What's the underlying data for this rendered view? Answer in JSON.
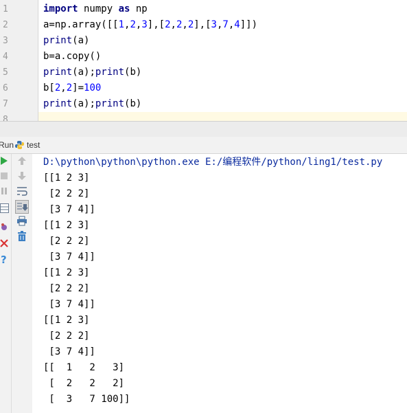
{
  "editor": {
    "line_numbers": [
      "1",
      "2",
      "3",
      "4",
      "5",
      "6",
      "7",
      "8"
    ],
    "lines": [
      {
        "segments": [
          {
            "t": "import",
            "c": "kw"
          },
          {
            "t": " numpy ",
            "c": ""
          },
          {
            "t": "as",
            "c": "kw"
          },
          {
            "t": " np",
            "c": ""
          }
        ]
      },
      {
        "segments": [
          {
            "t": "a=np.array([[",
            "c": ""
          },
          {
            "t": "1",
            "c": "num"
          },
          {
            "t": ",",
            "c": ""
          },
          {
            "t": "2",
            "c": "num"
          },
          {
            "t": ",",
            "c": ""
          },
          {
            "t": "3",
            "c": "num"
          },
          {
            "t": "],[",
            "c": ""
          },
          {
            "t": "2",
            "c": "num"
          },
          {
            "t": ",",
            "c": ""
          },
          {
            "t": "2",
            "c": "num"
          },
          {
            "t": ",",
            "c": ""
          },
          {
            "t": "2",
            "c": "num"
          },
          {
            "t": "],[",
            "c": ""
          },
          {
            "t": "3",
            "c": "num"
          },
          {
            "t": ",",
            "c": ""
          },
          {
            "t": "7",
            "c": "num"
          },
          {
            "t": ",",
            "c": ""
          },
          {
            "t": "4",
            "c": "num"
          },
          {
            "t": "]])",
            "c": ""
          }
        ]
      },
      {
        "segments": [
          {
            "t": "print",
            "c": "fn"
          },
          {
            "t": "(a)",
            "c": ""
          }
        ]
      },
      {
        "segments": [
          {
            "t": "b=a.copy()",
            "c": ""
          }
        ]
      },
      {
        "segments": [
          {
            "t": "print",
            "c": "fn"
          },
          {
            "t": "(a);",
            "c": ""
          },
          {
            "t": "print",
            "c": "fn"
          },
          {
            "t": "(b)",
            "c": ""
          }
        ]
      },
      {
        "segments": [
          {
            "t": "b[",
            "c": ""
          },
          {
            "t": "2",
            "c": "num"
          },
          {
            "t": ",",
            "c": ""
          },
          {
            "t": "2",
            "c": "num"
          },
          {
            "t": "]=",
            "c": ""
          },
          {
            "t": "100",
            "c": "num"
          }
        ]
      },
      {
        "segments": [
          {
            "t": "print",
            "c": "fn"
          },
          {
            "t": "(a);",
            "c": ""
          },
          {
            "t": "print",
            "c": "fn"
          },
          {
            "t": "(b)",
            "c": ""
          }
        ]
      },
      {
        "segments": []
      }
    ]
  },
  "run_panel": {
    "label": "Run",
    "tab_name": "test",
    "tab_icon": "python-file-icon",
    "left_icons": [
      "run-icon",
      "stop-icon",
      "pause-icon",
      "layout-icon",
      "debug-icon",
      "close-icon",
      "help-icon"
    ],
    "right_icons": [
      "up-arrow-icon",
      "down-arrow-icon",
      "soft-wrap-icon",
      "scroll-to-end-icon",
      "print-icon",
      "trash-icon"
    ]
  },
  "console": {
    "command": "D:\\python\\python\\python.exe E:/编程软件/python/ling1/test.py",
    "output": [
      "[[1 2 3]",
      " [2 2 2]",
      " [3 7 4]]",
      "[[1 2 3]",
      " [2 2 2]",
      " [3 7 4]]",
      "[[1 2 3]",
      " [2 2 2]",
      " [3 7 4]]",
      "[[1 2 3]",
      " [2 2 2]",
      " [3 7 4]]",
      "[[  1   2   3]",
      " [  2   2   2]",
      " [  3   7 100]]"
    ]
  },
  "colors": {
    "keyword": "#000080",
    "number": "#0000ff",
    "current_line": "#fffae3",
    "console_command": "#0a2a9e"
  }
}
